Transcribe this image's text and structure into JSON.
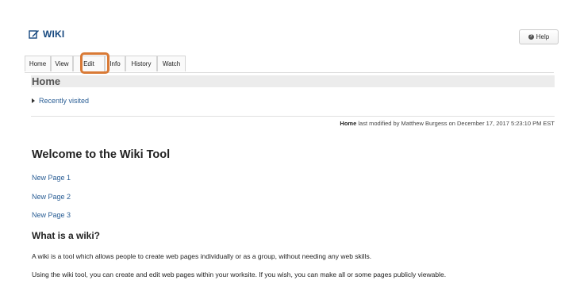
{
  "tool": {
    "title": "WIKI",
    "help_label": "Help"
  },
  "tabs": [
    {
      "label": "Home"
    },
    {
      "label": "View"
    },
    {
      "label": "Edit"
    },
    {
      "label": "Info"
    },
    {
      "label": "History"
    },
    {
      "label": "Watch"
    }
  ],
  "page": {
    "title": "Home",
    "recently_visited": "Recently visited",
    "modified_page": "Home",
    "modified_text": "last modified by Matthew Burgess on December 17, 2017 5:23:10 PM EST"
  },
  "content": {
    "heading": "Welcome to the Wiki Tool",
    "links": [
      "New Page 1",
      "New Page 2",
      "New Page 3"
    ],
    "subheading": "What is a wiki?",
    "paragraphs": [
      "A wiki is a tool which allows people to create web pages individually or as a group, without needing any web skills.",
      "Using the wiki tool, you can create and edit web pages within your worksite. If you wish, you can make all or some pages publicly viewable."
    ]
  },
  "colors": {
    "highlight": "#d97a36",
    "link": "#2a5e95",
    "title": "#15487f"
  }
}
